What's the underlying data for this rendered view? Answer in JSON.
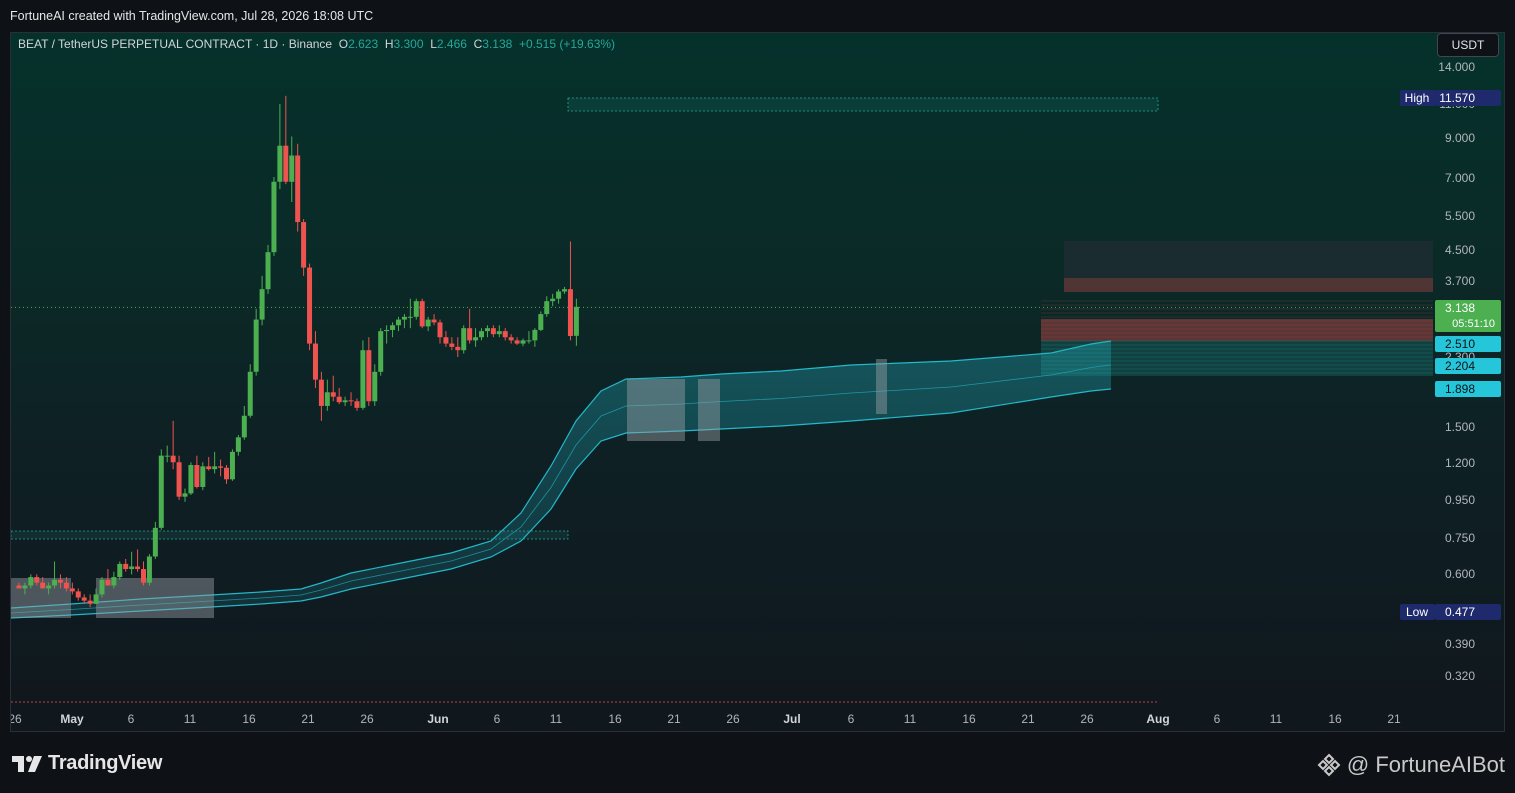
{
  "header": {
    "creator_line": "FortuneAI created with TradingView.com, Jul 28, 2026 18:08 UTC"
  },
  "legend": {
    "symbol": "BEAT / TetherUS PERPETUAL CONTRACT · 1D · Binance",
    "o_label": "O",
    "o_value": "2.623",
    "h_label": "H",
    "h_value": "3.300",
    "l_label": "L",
    "l_value": "2.466",
    "c_label": "C",
    "c_value": "3.138",
    "change": "+0.515 (+19.63%)"
  },
  "currency_button": "USDT",
  "footer": {
    "brand": "TradingView",
    "attribution": "@ FortuneAIBot"
  },
  "colors": {
    "up": "#26a69a",
    "up_body": "#4caf50",
    "down": "#ef5350",
    "band": "#26c6da",
    "label_blue": "#26c6da",
    "label_green": "#4caf50",
    "label_navy": "#1e2a6b"
  },
  "chart_data": {
    "type": "candlestick",
    "interval": "1D",
    "scale": "log",
    "x_ticks": [
      "26",
      "May",
      "6",
      "11",
      "16",
      "21",
      "26",
      "Jun",
      "6",
      "11",
      "16",
      "21",
      "26",
      "Jul",
      "6",
      "11",
      "16",
      "21",
      "26",
      "Aug",
      "6",
      "11",
      "16",
      "21"
    ],
    "y_ticks": [
      "14.000",
      "11.000",
      "9.000",
      "7.000",
      "5.500",
      "4.500",
      "3.700",
      "3.138",
      "2.510",
      "2.300",
      "2.204",
      "1.898",
      "1.500",
      "1.200",
      "0.950",
      "0.750",
      "0.600",
      "0.390",
      "0.320"
    ],
    "price_labels": [
      {
        "text": "High",
        "value": "11.570"
      },
      {
        "text": "",
        "value": "3.138",
        "sub": "05:51:10"
      },
      {
        "text": "",
        "value": "2.510"
      },
      {
        "text": "",
        "value": "2.204"
      },
      {
        "text": "",
        "value": "1.898"
      },
      {
        "text": "Low",
        "value": "0.477"
      }
    ],
    "candles": [
      [
        0.56,
        0.57,
        0.55,
        0.55
      ],
      [
        0.55,
        0.57,
        0.53,
        0.56
      ],
      [
        0.56,
        0.6,
        0.55,
        0.59
      ],
      [
        0.59,
        0.6,
        0.56,
        0.57
      ],
      [
        0.57,
        0.59,
        0.55,
        0.55
      ],
      [
        0.55,
        0.57,
        0.53,
        0.56
      ],
      [
        0.56,
        0.65,
        0.55,
        0.58
      ],
      [
        0.58,
        0.6,
        0.55,
        0.57
      ],
      [
        0.57,
        0.59,
        0.54,
        0.55
      ],
      [
        0.55,
        0.57,
        0.53,
        0.54
      ],
      [
        0.54,
        0.55,
        0.51,
        0.52
      ],
      [
        0.52,
        0.53,
        0.5,
        0.51
      ],
      [
        0.51,
        0.53,
        0.49,
        0.5
      ],
      [
        0.5,
        0.55,
        0.5,
        0.53
      ],
      [
        0.53,
        0.59,
        0.52,
        0.58
      ],
      [
        0.58,
        0.62,
        0.56,
        0.56
      ],
      [
        0.56,
        0.61,
        0.55,
        0.59
      ],
      [
        0.59,
        0.65,
        0.58,
        0.64
      ],
      [
        0.64,
        0.66,
        0.61,
        0.62
      ],
      [
        0.62,
        0.69,
        0.6,
        0.63
      ],
      [
        0.63,
        0.7,
        0.61,
        0.62
      ],
      [
        0.62,
        0.65,
        0.56,
        0.57
      ],
      [
        0.57,
        0.68,
        0.56,
        0.67
      ],
      [
        0.67,
        0.83,
        0.66,
        0.8
      ],
      [
        0.8,
        1.3,
        0.79,
        1.25
      ],
      [
        1.25,
        1.33,
        1.2,
        1.25
      ],
      [
        1.25,
        1.55,
        1.15,
        1.2
      ],
      [
        1.2,
        1.25,
        0.95,
        0.97
      ],
      [
        0.97,
        1.02,
        0.94,
        0.99
      ],
      [
        0.99,
        1.2,
        0.98,
        1.18
      ],
      [
        1.18,
        1.25,
        1.02,
        1.03
      ],
      [
        1.03,
        1.2,
        1.01,
        1.17
      ],
      [
        1.17,
        1.24,
        1.14,
        1.15
      ],
      [
        1.15,
        1.28,
        1.12,
        1.17
      ],
      [
        1.17,
        1.22,
        1.1,
        1.16
      ],
      [
        1.16,
        1.18,
        1.05,
        1.08
      ],
      [
        1.08,
        1.3,
        1.07,
        1.28
      ],
      [
        1.28,
        1.42,
        1.25,
        1.4
      ],
      [
        1.4,
        1.7,
        1.38,
        1.6
      ],
      [
        1.6,
        2.2,
        1.58,
        2.1
      ],
      [
        2.1,
        3.1,
        2.05,
        2.9
      ],
      [
        2.9,
        3.8,
        2.8,
        3.5
      ],
      [
        3.5,
        4.6,
        3.4,
        4.4
      ],
      [
        4.4,
        7.0,
        4.3,
        6.8
      ],
      [
        6.8,
        11.0,
        6.5,
        8.5
      ],
      [
        8.5,
        11.57,
        6.7,
        6.8
      ],
      [
        6.8,
        9.0,
        6.0,
        8.0
      ],
      [
        8.0,
        8.6,
        5.0,
        5.3
      ],
      [
        5.3,
        5.4,
        3.8,
        4.0
      ],
      [
        4.0,
        4.1,
        2.4,
        2.5
      ],
      [
        2.5,
        2.7,
        1.9,
        2.0
      ],
      [
        2.0,
        2.1,
        1.55,
        1.7
      ],
      [
        1.7,
        2.0,
        1.65,
        1.85
      ],
      [
        1.85,
        2.05,
        1.75,
        1.8
      ],
      [
        1.8,
        1.9,
        1.72,
        1.74
      ],
      [
        1.74,
        1.8,
        1.7,
        1.76
      ],
      [
        1.76,
        1.85,
        1.7,
        1.75
      ],
      [
        1.75,
        1.78,
        1.65,
        1.68
      ],
      [
        1.68,
        2.55,
        1.66,
        2.4
      ],
      [
        2.4,
        2.6,
        1.7,
        1.75
      ],
      [
        1.75,
        2.2,
        1.7,
        2.1
      ],
      [
        2.1,
        2.75,
        2.05,
        2.7
      ],
      [
        2.7,
        2.8,
        2.5,
        2.72
      ],
      [
        2.72,
        2.85,
        2.6,
        2.8
      ],
      [
        2.8,
        2.95,
        2.7,
        2.9
      ],
      [
        2.9,
        3.0,
        2.75,
        2.95
      ],
      [
        2.95,
        3.3,
        2.75,
        2.95
      ],
      [
        2.95,
        3.3,
        2.9,
        3.25
      ],
      [
        3.25,
        3.3,
        2.75,
        2.78
      ],
      [
        2.78,
        2.95,
        2.7,
        2.9
      ],
      [
        2.9,
        3.0,
        2.8,
        2.85
      ],
      [
        2.85,
        2.9,
        2.5,
        2.6
      ],
      [
        2.6,
        2.7,
        2.45,
        2.5
      ],
      [
        2.5,
        2.6,
        2.4,
        2.45
      ],
      [
        2.45,
        2.6,
        2.3,
        2.4
      ],
      [
        2.4,
        2.8,
        2.35,
        2.75
      ],
      [
        2.75,
        3.1,
        2.5,
        2.55
      ],
      [
        2.55,
        2.75,
        2.45,
        2.6
      ],
      [
        2.6,
        2.75,
        2.55,
        2.7
      ],
      [
        2.7,
        2.8,
        2.6,
        2.75
      ],
      [
        2.75,
        2.8,
        2.6,
        2.65
      ],
      [
        2.65,
        2.8,
        2.6,
        2.7
      ],
      [
        2.7,
        2.75,
        2.55,
        2.6
      ],
      [
        2.6,
        2.65,
        2.5,
        2.55
      ],
      [
        2.55,
        2.6,
        2.48,
        2.5
      ],
      [
        2.5,
        2.58,
        2.46,
        2.55
      ],
      [
        2.55,
        2.7,
        2.5,
        2.55
      ],
      [
        2.55,
        2.75,
        2.45,
        2.72
      ],
      [
        2.72,
        3.05,
        2.7,
        3.0
      ],
      [
        3.0,
        3.35,
        2.95,
        3.25
      ],
      [
        3.25,
        3.4,
        3.15,
        3.3
      ],
      [
        3.3,
        3.5,
        3.2,
        3.45
      ],
      [
        3.45,
        3.55,
        3.4,
        3.5
      ],
      [
        3.5,
        4.7,
        2.55,
        2.62
      ],
      [
        2.623,
        3.3,
        2.466,
        3.138
      ]
    ]
  }
}
